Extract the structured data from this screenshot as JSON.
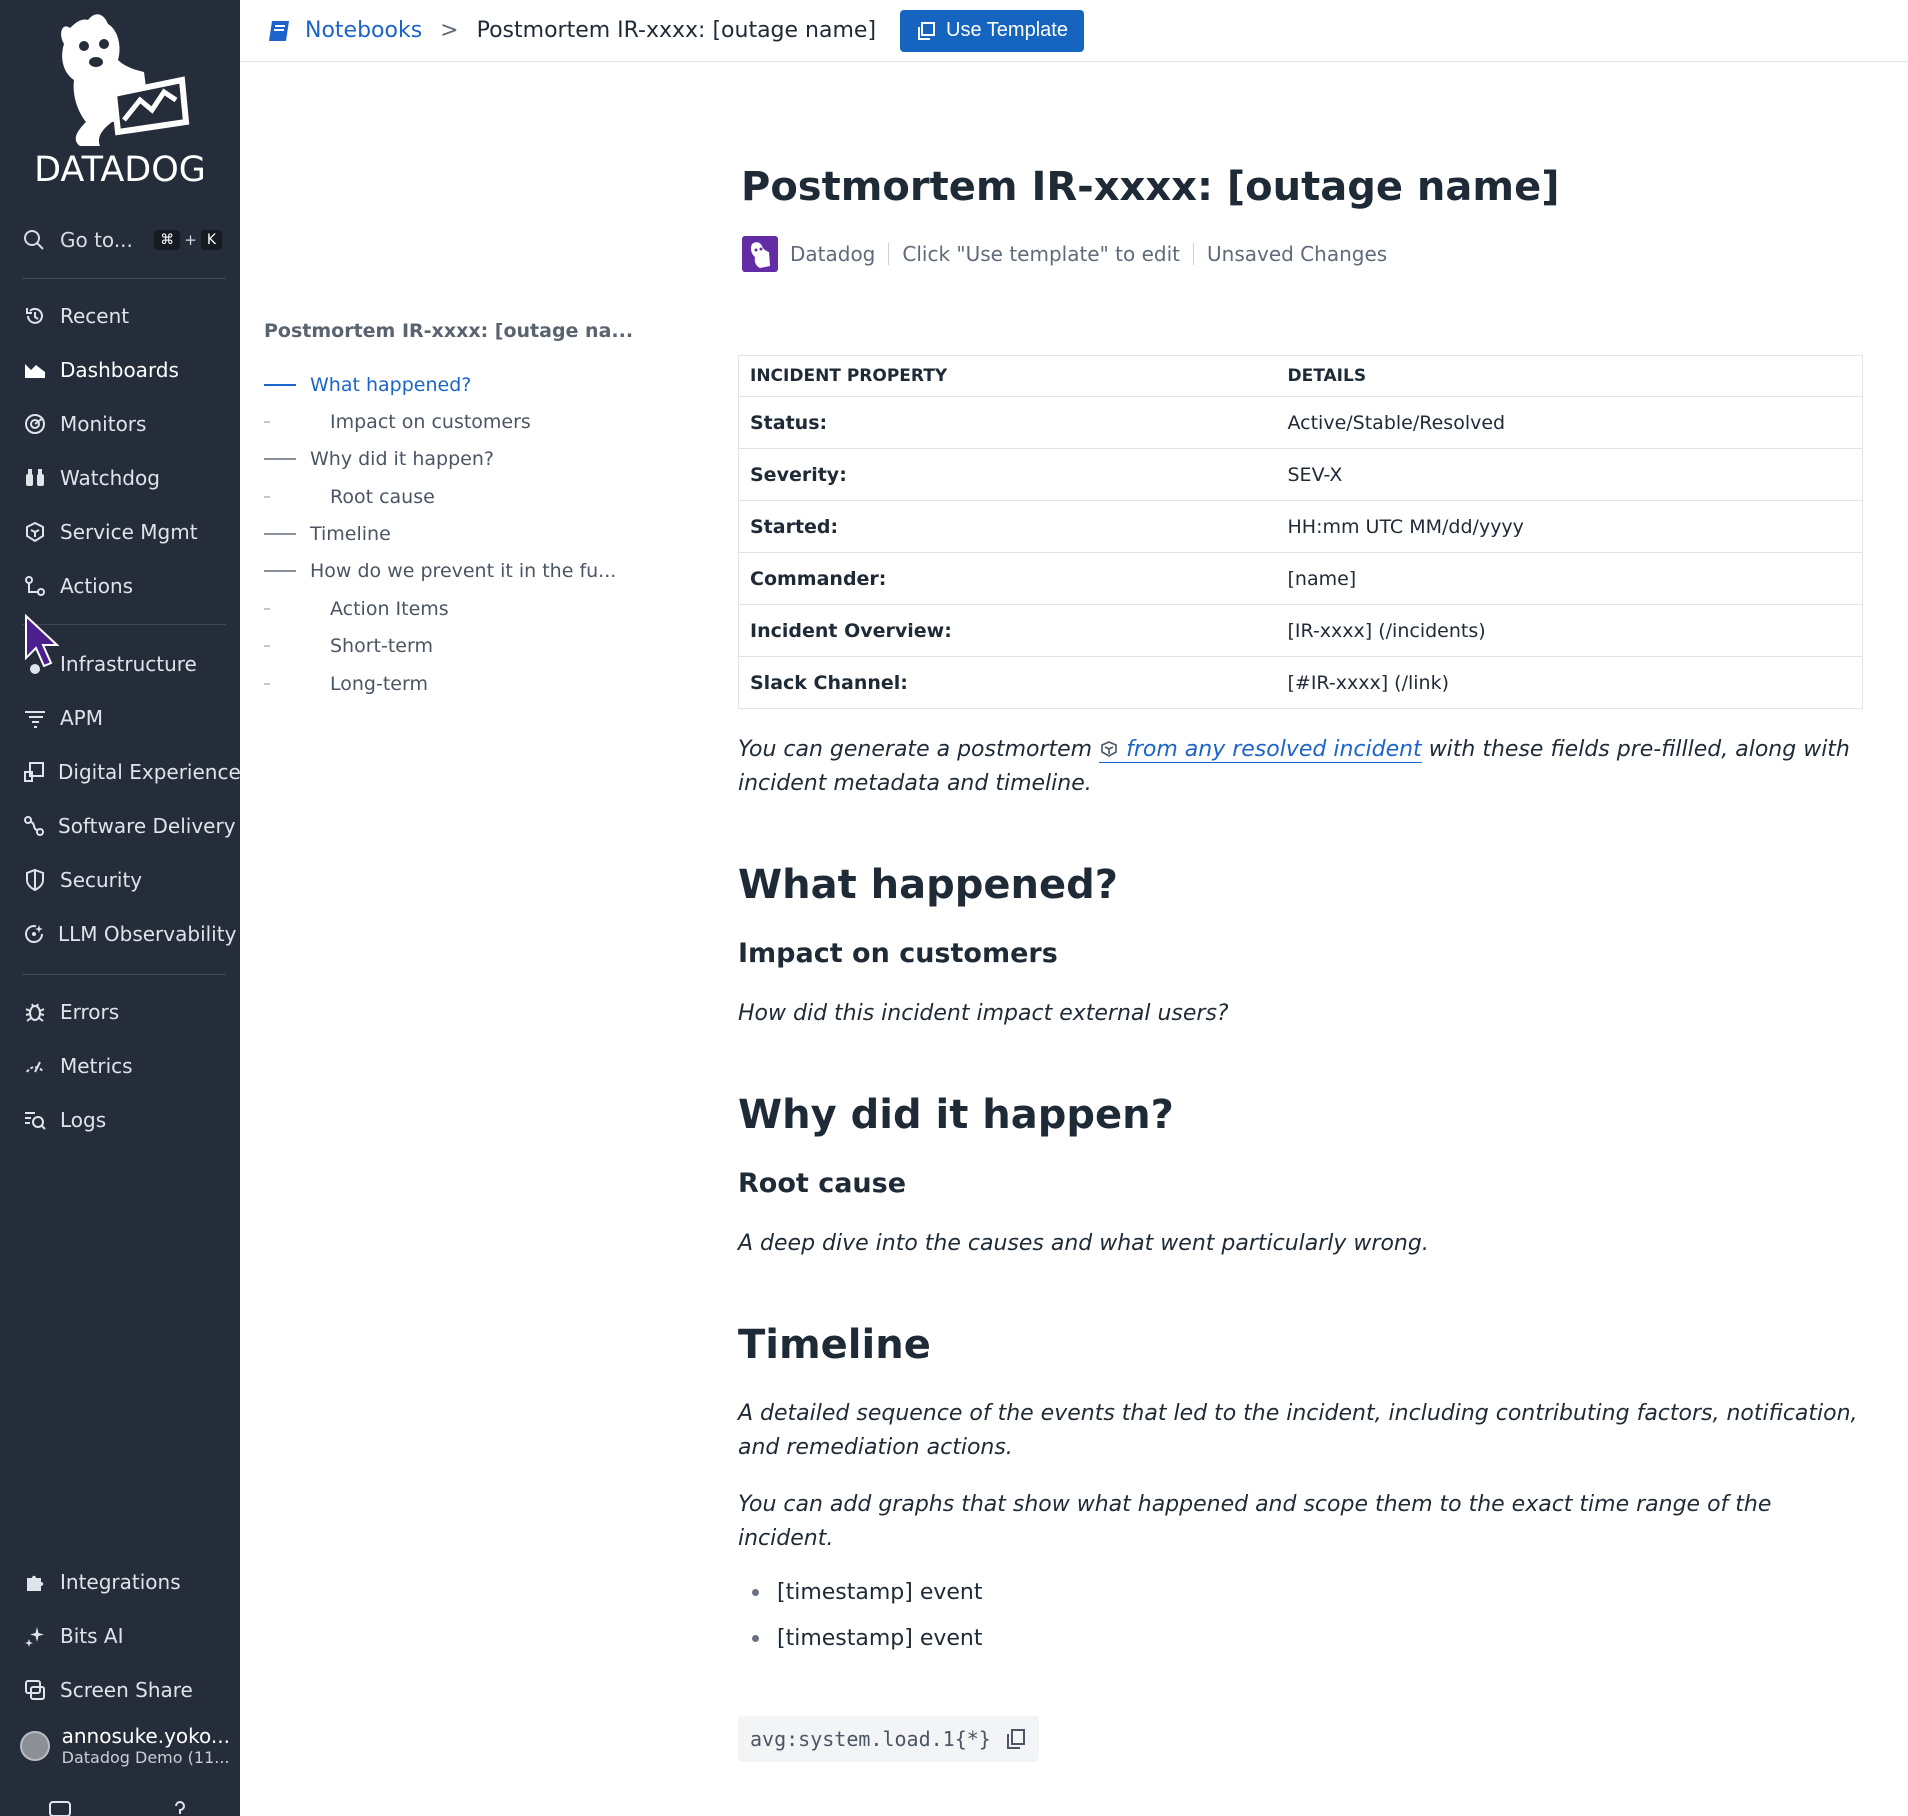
{
  "sidebar": {
    "brand": "DATADOG",
    "goto": {
      "label": "Go to...",
      "key1": "⌘",
      "plus": "+",
      "key2": "K"
    },
    "items": [
      {
        "label": "Recent",
        "icon": "history-icon"
      },
      {
        "label": "Dashboards",
        "icon": "dashboard-chart-icon"
      },
      {
        "label": "Monitors",
        "icon": "monitor-icon"
      },
      {
        "label": "Watchdog",
        "icon": "binoculars-icon"
      },
      {
        "label": "Service Mgmt",
        "icon": "service-mgmt-icon"
      },
      {
        "label": "Actions",
        "icon": "actions-icon"
      },
      {
        "label": "Infrastructure",
        "icon": "infrastructure-icon"
      },
      {
        "label": "APM",
        "icon": "apm-icon"
      },
      {
        "label": "Digital Experience",
        "icon": "digital-experience-icon"
      },
      {
        "label": "Software Delivery",
        "icon": "software-delivery-icon"
      },
      {
        "label": "Security",
        "icon": "shield-icon"
      },
      {
        "label": "LLM Observability",
        "icon": "llm-icon"
      },
      {
        "label": "Errors",
        "icon": "bug-icon"
      },
      {
        "label": "Metrics",
        "icon": "metrics-icon"
      },
      {
        "label": "Logs",
        "icon": "logs-icon"
      },
      {
        "label": "Integrations",
        "icon": "puzzle-icon"
      },
      {
        "label": "Bits AI",
        "icon": "sparkle-icon"
      },
      {
        "label": "Screen Share",
        "icon": "screen-share-icon"
      }
    ],
    "user": {
      "name": "annosuke.yoko...",
      "org": "Datadog Demo (11..."
    }
  },
  "topbar": {
    "breadcrumb_link": "Notebooks",
    "breadcrumb_sep": ">",
    "breadcrumb_current": "Postmortem IR-xxxx: [outage name]",
    "use_template": "Use Template"
  },
  "toc": {
    "title": "Postmortem IR-xxxx: [outage na...",
    "items": [
      {
        "label": "What happened?"
      },
      {
        "label": "Impact on customers"
      },
      {
        "label": "Why did it happen?"
      },
      {
        "label": "Root cause"
      },
      {
        "label": "Timeline"
      },
      {
        "label": "How do we prevent it in the fu..."
      },
      {
        "label": "Action Items"
      },
      {
        "label": "Short-term"
      },
      {
        "label": "Long-term"
      }
    ]
  },
  "doc": {
    "title": "Postmortem IR-xxxx: [outage name]",
    "meta": {
      "author": "Datadog",
      "hint": "Click \"Use template\" to edit",
      "status": "Unsaved Changes"
    },
    "table": {
      "headers": [
        "INCIDENT PROPERTY",
        "DETAILS"
      ],
      "rows": [
        [
          "Status:",
          "Active/Stable/Resolved"
        ],
        [
          "Severity:",
          "SEV-X"
        ],
        [
          "Started:",
          "HH:mm UTC MM/dd/yyyy"
        ],
        [
          "Commander:",
          "[name]"
        ],
        [
          "Incident Overview:",
          "[IR-xxxx] (/incidents)"
        ],
        [
          "Slack Channel:",
          "[#IR-xxxx] (/link)"
        ]
      ]
    },
    "intro_before": "You can generate a postmortem",
    "intro_link": "from any resolved incident",
    "intro_after": "with these fields pre-fillled, along with incident metadata and timeline.",
    "what_happened": "What happened?",
    "impact_heading": "Impact on customers",
    "impact_text": "How did this incident impact external users?",
    "why_heading": "Why did it happen?",
    "root_cause_heading": "Root cause",
    "root_cause_text": "A deep dive into the causes and what went particularly wrong.",
    "timeline_heading": "Timeline",
    "timeline_text1": "A detailed sequence of the events that led to the incident, including contributing factors, notification, and remediation actions.",
    "timeline_text2": "You can add graphs that show what happened and scope them to the exact time range of the incident.",
    "bullets": [
      "[timestamp] event",
      "[timestamp] event"
    ],
    "code": "avg:system.load.1{*}"
  },
  "colors": {
    "sidebar_bg": "#262d3a",
    "accent": "#1565c0",
    "link": "#1c64c9"
  }
}
